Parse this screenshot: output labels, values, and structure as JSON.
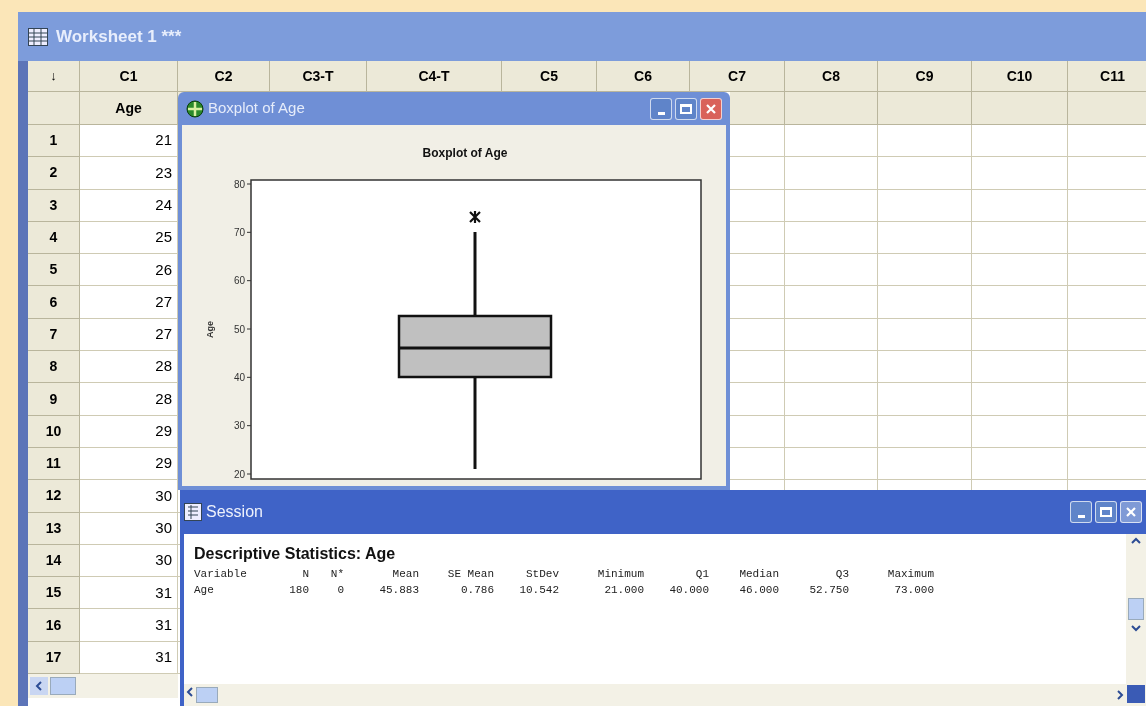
{
  "worksheet": {
    "title": "Worksheet 1 ***",
    "corner": "↓",
    "columns": [
      {
        "label": "C1",
        "name": "Age"
      },
      {
        "label": "C2"
      },
      {
        "label": "C3-T"
      },
      {
        "label": "C4-T"
      },
      {
        "label": "C5"
      },
      {
        "label": "C6"
      },
      {
        "label": "C7"
      },
      {
        "label": "C8"
      },
      {
        "label": "C9"
      },
      {
        "label": "C10"
      },
      {
        "label": "C11"
      }
    ],
    "rows": [
      {
        "number": "1",
        "value": "21"
      },
      {
        "number": "2",
        "value": "23"
      },
      {
        "number": "3",
        "value": "24"
      },
      {
        "number": "4",
        "value": "25"
      },
      {
        "number": "5",
        "value": "26"
      },
      {
        "number": "6",
        "value": "27"
      },
      {
        "number": "7",
        "value": "27"
      },
      {
        "number": "8",
        "value": "28"
      },
      {
        "number": "9",
        "value": "28"
      },
      {
        "number": "10",
        "value": "29"
      },
      {
        "number": "11",
        "value": "29"
      },
      {
        "number": "12",
        "value": "30"
      },
      {
        "number": "13",
        "value": "30"
      },
      {
        "number": "14",
        "value": "30"
      },
      {
        "number": "15",
        "value": "31"
      },
      {
        "number": "16",
        "value": "31"
      },
      {
        "number": "17",
        "value": "31"
      }
    ]
  },
  "graph_window": {
    "title": "Boxplot of Age",
    "chart_title": "Boxplot of Age",
    "axis_label": "Age",
    "axis_ticks": [
      "80",
      "70",
      "60",
      "50",
      "40",
      "30",
      "20"
    ]
  },
  "session": {
    "title": "Session",
    "heading": "Descriptive Statistics: Age",
    "columns": [
      "Variable",
      "N",
      "N*",
      "Mean",
      "SE Mean",
      "StDev",
      "Minimum",
      "Q1",
      "Median",
      "Q3",
      "Maximum"
    ],
    "rows": [
      [
        "Age",
        "180",
        "0",
        "45.883",
        "0.786",
        "10.542",
        "21.000",
        "40.000",
        "46.000",
        "52.750",
        "73.000"
      ]
    ]
  }
}
